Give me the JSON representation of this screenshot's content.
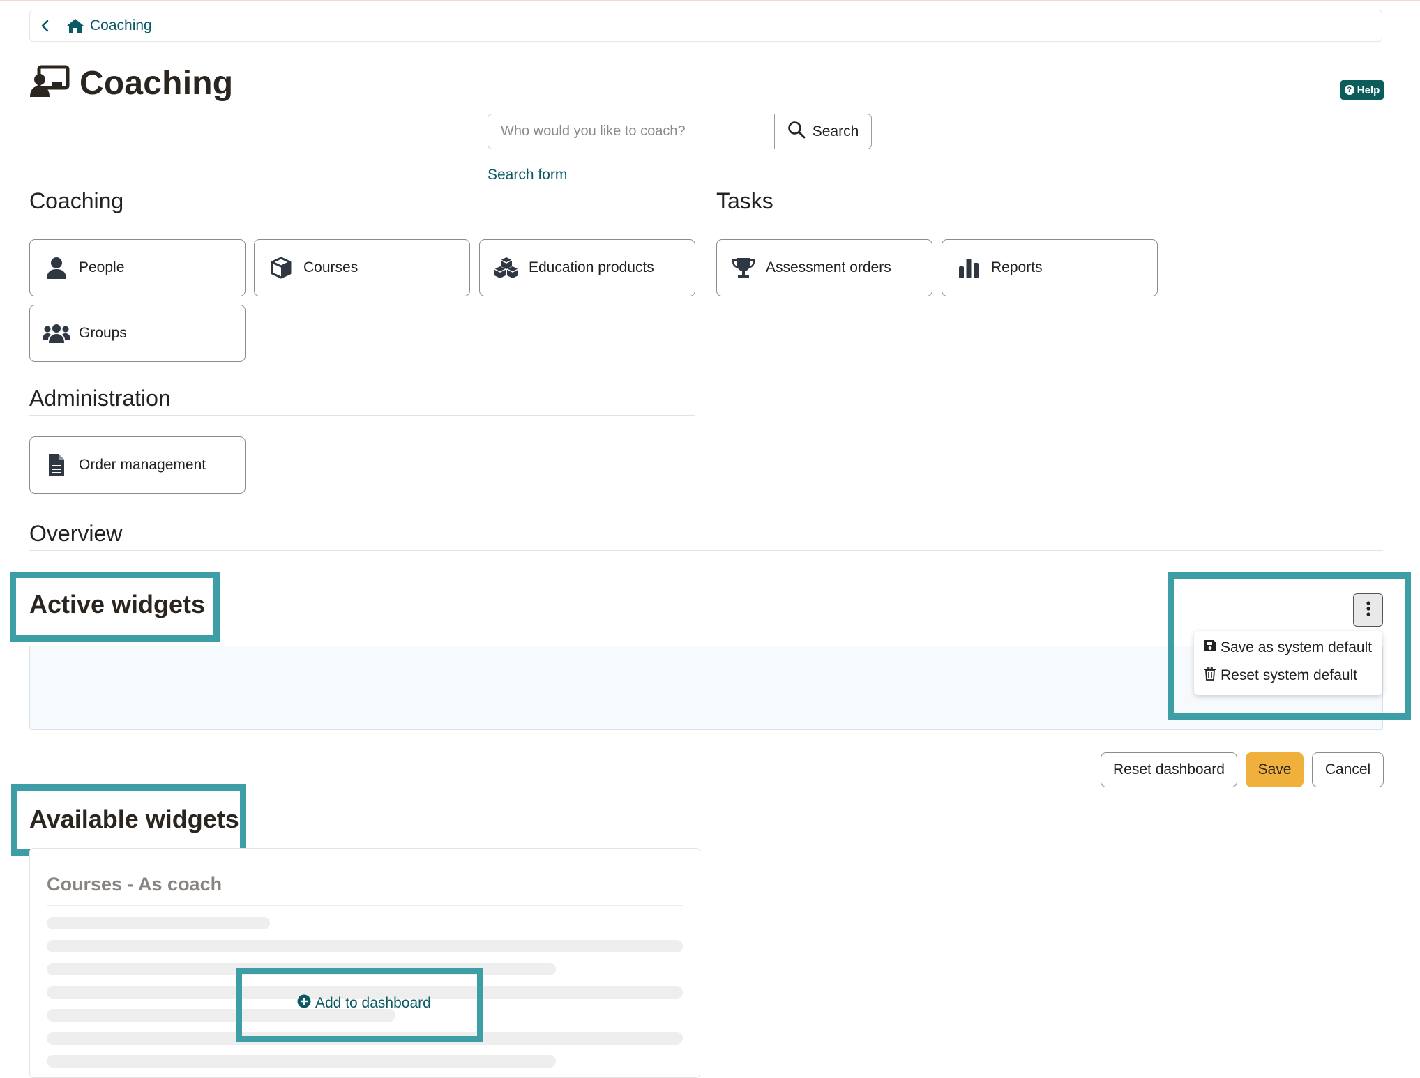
{
  "breadcrumb": {
    "label": "Coaching"
  },
  "page": {
    "title": "Coaching",
    "help_label": "Help"
  },
  "search": {
    "placeholder": "Who would you like to coach?",
    "button_label": "Search",
    "form_link": "Search form"
  },
  "sections": {
    "coaching": "Coaching",
    "tasks": "Tasks",
    "administration": "Administration",
    "overview": "Overview"
  },
  "tiles": {
    "people": "People",
    "courses": "Courses",
    "education_products": "Education products",
    "groups": "Groups",
    "assessment_orders": "Assessment orders",
    "reports": "Reports",
    "order_management": "Order management"
  },
  "widgets": {
    "active_heading": "Active widgets",
    "available_heading": "Available widgets",
    "menu": {
      "save_default": "Save as system default",
      "reset_default": "Reset system default"
    },
    "buttons": {
      "reset_dashboard": "Reset dashboard",
      "save": "Save",
      "cancel": "Cancel"
    },
    "card": {
      "title": "Courses - As coach",
      "add_label": "Add to dashboard"
    }
  },
  "colors": {
    "brand": "#0b5a63",
    "primary_button": "#f0b03c",
    "highlight": "#3e9ea6",
    "help_badge": "#0d5c5c"
  }
}
